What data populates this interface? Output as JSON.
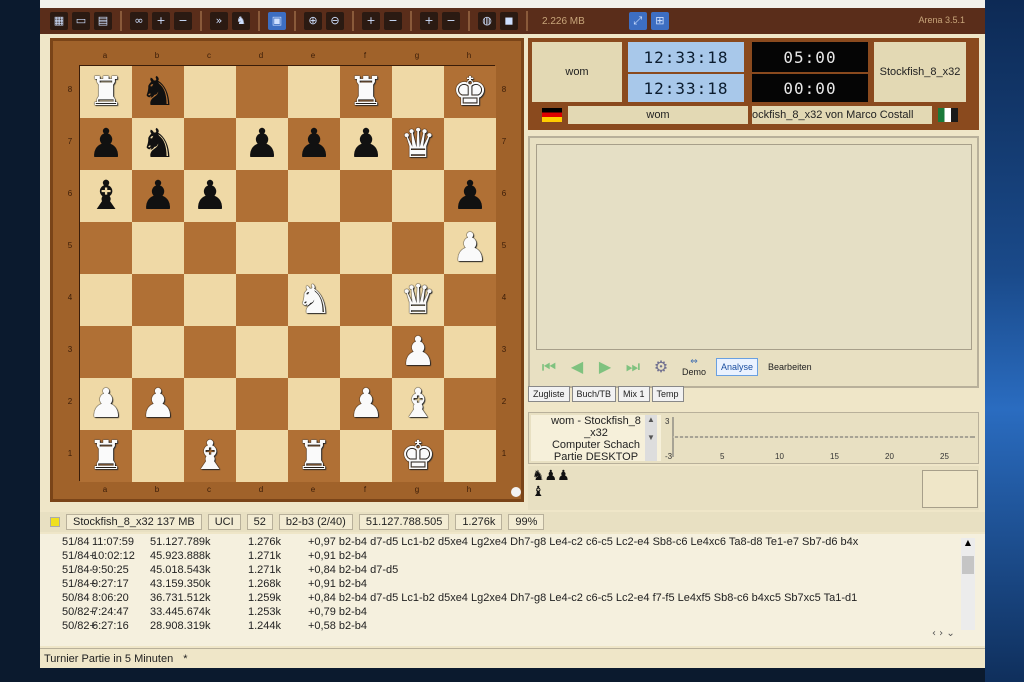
{
  "toolbar": {
    "buttons": [
      "board-icon",
      "open-icon",
      "save-icon",
      "infinity-icon",
      "plus-lev-icon",
      "minus-lev-icon",
      "forward-icon",
      "engine-icon",
      "tab-icon",
      "zoom-in-icon",
      "zoom-out-icon",
      "plus-pgn-icon",
      "minus-pgn-icon",
      "plus-epd-icon",
      "minus-epd-icon",
      "globe-icon",
      "oct-icon"
    ],
    "memory": "2.226 MB",
    "version": "Arena 3.5.1"
  },
  "board": {
    "files": [
      "a",
      "b",
      "c",
      "d",
      "e",
      "f",
      "g",
      "h"
    ],
    "ranks": [
      "8",
      "7",
      "6",
      "5",
      "4",
      "3",
      "2",
      "1"
    ],
    "squares": [
      [
        {
          "p": "♜",
          "c": "w"
        },
        {
          "p": "♞",
          "c": "b"
        },
        {
          "p": "",
          "c": ""
        },
        {
          "p": "",
          "c": ""
        },
        {
          "p": "",
          "c": ""
        },
        {
          "p": "♜",
          "c": "w"
        },
        {
          "p": "",
          "c": ""
        },
        {
          "p": "♚",
          "c": "w"
        }
      ],
      [
        {
          "p": "♟",
          "c": "b"
        },
        {
          "p": "♞",
          "c": "b"
        },
        {
          "p": "",
          "c": ""
        },
        {
          "p": "♟",
          "c": "b"
        },
        {
          "p": "♟",
          "c": "b"
        },
        {
          "p": "♟",
          "c": "b"
        },
        {
          "p": "♛",
          "c": "w"
        },
        {
          "p": "",
          "c": ""
        }
      ],
      [
        {
          "p": "♝",
          "c": "b"
        },
        {
          "p": "♟",
          "c": "b"
        },
        {
          "p": "♟",
          "c": "b"
        },
        {
          "p": "",
          "c": ""
        },
        {
          "p": "",
          "c": ""
        },
        {
          "p": "",
          "c": ""
        },
        {
          "p": "",
          "c": ""
        },
        {
          "p": "♟",
          "c": "b"
        }
      ],
      [
        {
          "p": "",
          "c": ""
        },
        {
          "p": "",
          "c": ""
        },
        {
          "p": "",
          "c": ""
        },
        {
          "p": "",
          "c": ""
        },
        {
          "p": "",
          "c": ""
        },
        {
          "p": "",
          "c": ""
        },
        {
          "p": "",
          "c": ""
        },
        {
          "p": "♟",
          "c": "w"
        }
      ],
      [
        {
          "p": "",
          "c": ""
        },
        {
          "p": "",
          "c": ""
        },
        {
          "p": "",
          "c": ""
        },
        {
          "p": "",
          "c": ""
        },
        {
          "p": "♞",
          "c": "w"
        },
        {
          "p": "",
          "c": ""
        },
        {
          "p": "♛",
          "c": "w"
        },
        {
          "p": "",
          "c": ""
        }
      ],
      [
        {
          "p": "",
          "c": ""
        },
        {
          "p": "",
          "c": ""
        },
        {
          "p": "",
          "c": ""
        },
        {
          "p": "",
          "c": ""
        },
        {
          "p": "",
          "c": ""
        },
        {
          "p": "",
          "c": ""
        },
        {
          "p": "♟",
          "c": "w"
        },
        {
          "p": "",
          "c": ""
        }
      ],
      [
        {
          "p": "♟",
          "c": "w"
        },
        {
          "p": "♟",
          "c": "w"
        },
        {
          "p": "",
          "c": ""
        },
        {
          "p": "",
          "c": ""
        },
        {
          "p": "",
          "c": ""
        },
        {
          "p": "♟",
          "c": "w"
        },
        {
          "p": "♝",
          "c": "w"
        },
        {
          "p": "",
          "c": ""
        }
      ],
      [
        {
          "p": "♜",
          "c": "w"
        },
        {
          "p": "",
          "c": ""
        },
        {
          "p": "♝",
          "c": "w"
        },
        {
          "p": "",
          "c": ""
        },
        {
          "p": "♜",
          "c": "w"
        },
        {
          "p": "",
          "c": ""
        },
        {
          "p": "♚",
          "c": "w"
        },
        {
          "p": "",
          "c": ""
        }
      ]
    ]
  },
  "clock": {
    "white_player": "wom",
    "white_time_main": "12:33:18",
    "white_time_sub": "12:33:18",
    "black_time_main": "05:00",
    "black_time_sub": "00:00",
    "black_player": "Stockfish_8_x32",
    "white_label": "wom",
    "black_label": "ockfish_8_x32 von Marco Costall"
  },
  "controls": {
    "demo": "Demo",
    "analyse": "Analyse",
    "bearbeiten": "Bearbeiten"
  },
  "tabs": [
    "Zugliste",
    "Buch/TB",
    "Mix 1",
    "Temp"
  ],
  "book": {
    "line1": "wom - Stockfish_8",
    "line2": "_x32",
    "line3": "Computer Schach",
    "line4": "Partie DESKTOP"
  },
  "graph": {
    "y_top": "3",
    "y_bottom": "-3",
    "x_ticks": [
      "5",
      "10",
      "15",
      "20",
      "25"
    ]
  },
  "engine": {
    "name": "Stockfish_8_x32",
    "memory": "137 MB",
    "protocol": "UCI",
    "depth": "52",
    "current_move": "b2-b3 (2/40)",
    "nodes": "51.127.788.505",
    "nps": "1.276k",
    "hash": "99%"
  },
  "analysis_lines": [
    {
      "depth": "51/84",
      "time": "11:07:59",
      "nodes": "51.127.789k",
      "nps": "1.276k",
      "pv": "+0,97  b2-b4  d7-d5  Lc1-b2  d5xe4  Lg2xe4  Dh7-g8  Le4-c2  c6-c5  Lc2-e4  Sb8-c6  Le4xc6  Ta8-d8  Te1-e7  Sb7-d6  b4x"
    },
    {
      "depth": "51/84+",
      "time": "10:02:12",
      "nodes": "45.923.888k",
      "nps": "1.271k",
      "pv": "+0,91  b2-b4"
    },
    {
      "depth": "51/84-",
      "time": "9:50:25",
      "nodes": "45.018.543k",
      "nps": "1.271k",
      "pv": "+0,84  b2-b4  d7-d5"
    },
    {
      "depth": "51/84+",
      "time": "9:27:17",
      "nodes": "43.159.350k",
      "nps": "1.268k",
      "pv": "+0,91  b2-b4"
    },
    {
      "depth": "50/84",
      "time": "8:06:20",
      "nodes": "36.731.512k",
      "nps": "1.259k",
      "pv": "+0,84  b2-b4  d7-d5  Lc1-b2  d5xe4  Lg2xe4  Dh7-g8  Le4-c2  c6-c5  Lc2-e4  f7-f5  Le4xf5  Sb8-c6  b4xc5  Sb7xc5  Ta1-d1"
    },
    {
      "depth": "50/82+",
      "time": "7:24:47",
      "nodes": "33.445.674k",
      "nps": "1.253k",
      "pv": "+0,79  b2-b4"
    },
    {
      "depth": "50/82+",
      "time": "6:27:16",
      "nodes": "28.908.319k",
      "nps": "1.244k",
      "pv": "+0,58  b2-b4"
    }
  ],
  "status": {
    "text": "Turnier Partie in 5 Minuten",
    "marker": "*"
  }
}
